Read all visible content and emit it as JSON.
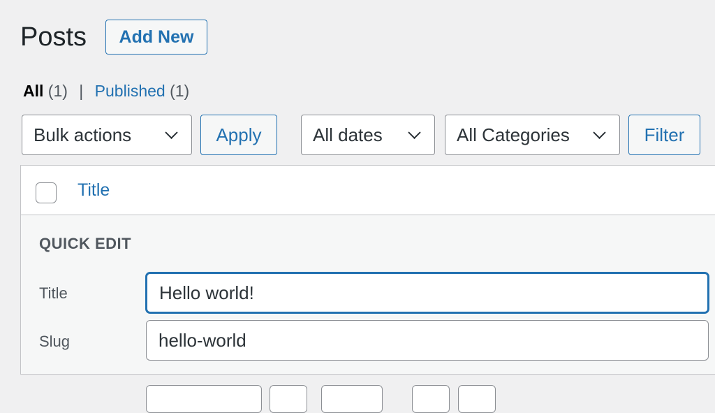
{
  "header": {
    "title": "Posts",
    "add_new_label": "Add New"
  },
  "views": {
    "all_label": "All",
    "all_count": "(1)",
    "separator": "|",
    "published_label": "Published",
    "published_count": "(1)"
  },
  "toolbar": {
    "bulk_actions": "Bulk actions",
    "apply_label": "Apply",
    "dates_filter": "All dates",
    "categories_filter": "All Categories",
    "filter_label": "Filter"
  },
  "table": {
    "column_title": "Title"
  },
  "quick_edit": {
    "legend": "QUICK EDIT",
    "title_label": "Title",
    "title_value": "Hello world!",
    "slug_label": "Slug",
    "slug_value": "hello-world"
  },
  "colors": {
    "accent": "#2271b1",
    "page_background": "#f0f0f1",
    "text": "#1d2327"
  }
}
